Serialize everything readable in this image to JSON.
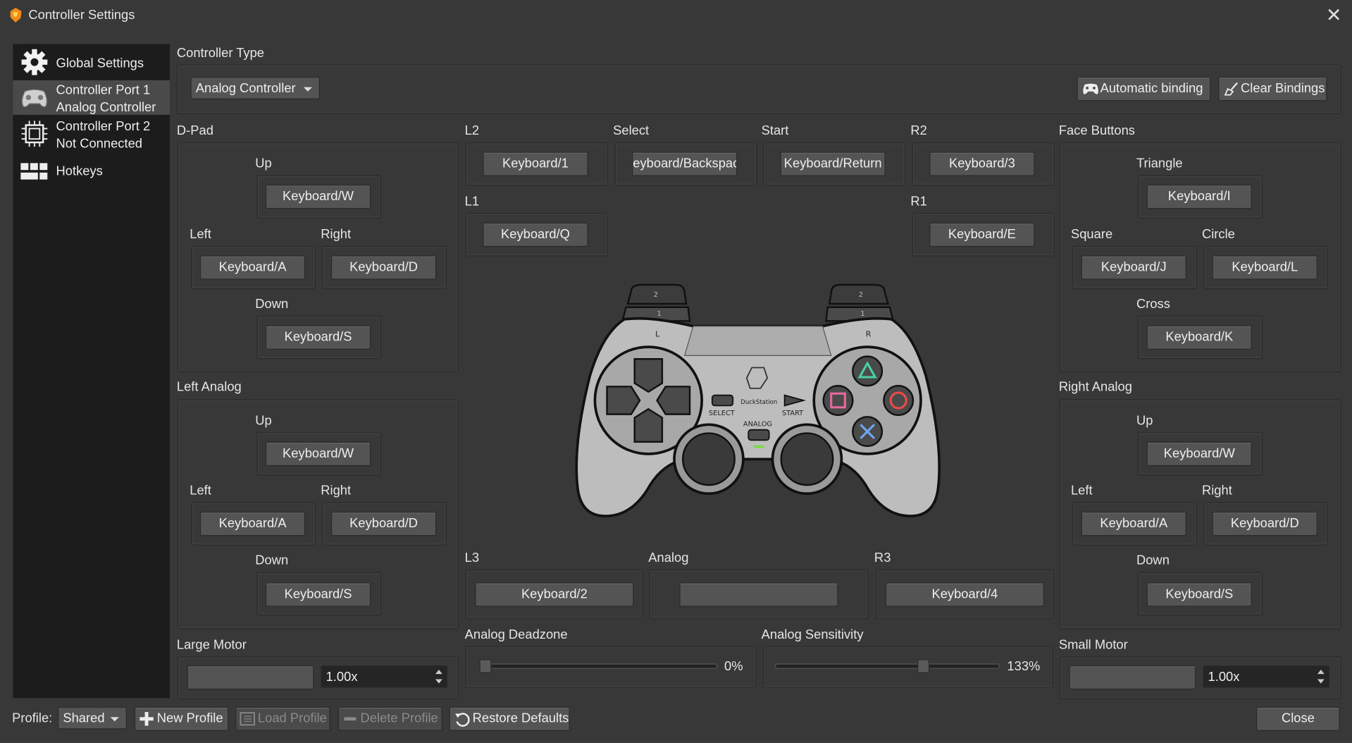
{
  "window": {
    "title": "Controller Settings",
    "close_glyph": "✕"
  },
  "sidebar": {
    "items": [
      {
        "label1": "Global Settings",
        "label2": "",
        "icon": "gear-icon"
      },
      {
        "label1": "Controller Port 1",
        "label2": "Analog Controller",
        "icon": "gamepad-icon"
      },
      {
        "label1": "Controller Port 2",
        "label2": "Not Connected",
        "icon": "chip-icon"
      },
      {
        "label1": "Hotkeys",
        "label2": "",
        "icon": "keyboard-icon"
      }
    ]
  },
  "controller_type": {
    "heading": "Controller Type",
    "value": "Analog Controller"
  },
  "actions": {
    "automatic_binding": "Automatic binding",
    "clear_bindings": "Clear Bindings"
  },
  "dpad": {
    "heading": "D-Pad",
    "up_label": "Up",
    "up": "Keyboard/W",
    "left_label": "Left",
    "left": "Keyboard/A",
    "right_label": "Right",
    "right": "Keyboard/D",
    "down_label": "Down",
    "down": "Keyboard/S"
  },
  "left_analog": {
    "heading": "Left Analog",
    "up_label": "Up",
    "up": "Keyboard/W",
    "left_label": "Left",
    "left": "Keyboard/A",
    "right_label": "Right",
    "right": "Keyboard/D",
    "down_label": "Down",
    "down": "Keyboard/S"
  },
  "face": {
    "heading": "Face Buttons",
    "triangle_label": "Triangle",
    "triangle": "Keyboard/I",
    "square_label": "Square",
    "square": "Keyboard/J",
    "circle_label": "Circle",
    "circle": "Keyboard/L",
    "cross_label": "Cross",
    "cross": "Keyboard/K"
  },
  "right_analog": {
    "heading": "Right Analog",
    "up_label": "Up",
    "up": "Keyboard/W",
    "left_label": "Left",
    "left": "Keyboard/A",
    "right_label": "Right",
    "right": "Keyboard/D",
    "down_label": "Down",
    "down": "Keyboard/S"
  },
  "center": {
    "l2_label": "L2",
    "l2": "Keyboard/1",
    "select_label": "Select",
    "select": "eyboard/Backspac",
    "start_label": "Start",
    "start": "Keyboard/Return",
    "r2_label": "R2",
    "r2": "Keyboard/3",
    "l1_label": "L1",
    "l1": "Keyboard/Q",
    "r1_label": "R1",
    "r1": "Keyboard/E",
    "l3_label": "L3",
    "l3": "Keyboard/2",
    "analog_label": "Analog",
    "analog": "",
    "r3_label": "R3",
    "r3": "Keyboard/4"
  },
  "pad_image": {
    "select": "SELECT",
    "start": "START",
    "analog": "ANALOG",
    "brand": "DuckStation",
    "l": "L",
    "r": "R",
    "one": "1",
    "two": "2"
  },
  "motors": {
    "large_label": "Large Motor",
    "large_value": "1.00x",
    "small_label": "Small Motor",
    "small_value": "1.00x"
  },
  "deadzone": {
    "label": "Analog Deadzone",
    "value_text": "0%",
    "value": 0
  },
  "sensitivity": {
    "label": "Analog Sensitivity",
    "value_text": "133%",
    "value": 133
  },
  "footer": {
    "profile_label": "Profile:",
    "profile_value": "Shared",
    "new_profile": "New Profile",
    "load_profile": "Load Profile",
    "delete_profile": "Delete Profile",
    "restore_defaults": "Restore Defaults",
    "close": "Close"
  }
}
